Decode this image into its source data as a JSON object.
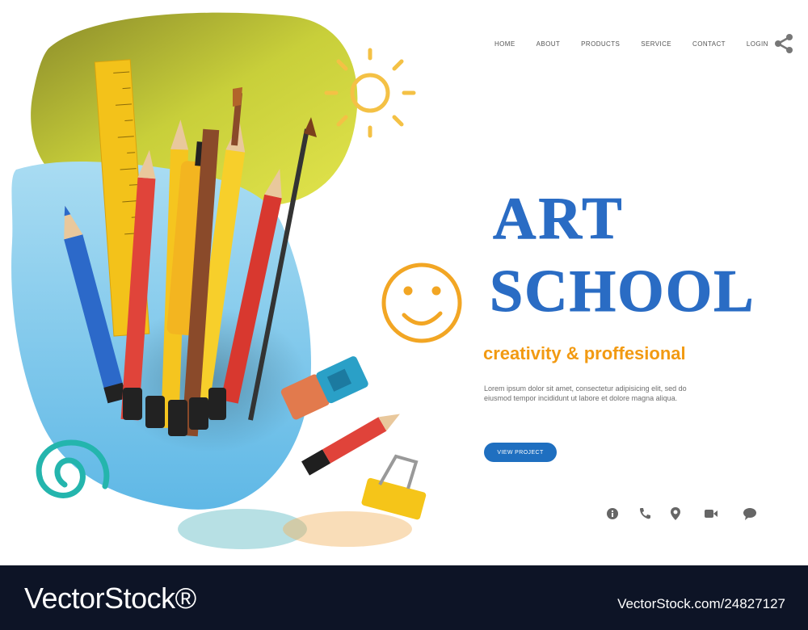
{
  "nav": {
    "items": [
      {
        "label": "HOME"
      },
      {
        "label": "ABOUT"
      },
      {
        "label": "PRODUCTS"
      },
      {
        "label": "SERVICE"
      },
      {
        "label": "CONTACT"
      },
      {
        "label": "LOGIN"
      }
    ],
    "share_icon": "share-icon"
  },
  "hero": {
    "title_line1": "ART",
    "title_line2": "SCHOOL",
    "tagline": "creativity & proffesional",
    "body": "Lorem ipsum dolor sit amet, consectetur adipisicing elit, sed do eiusmod tempor incididunt ut labore et dolore magna aliqua.",
    "cta_label": "VIEW PROJECT"
  },
  "contact_icons": [
    "info-icon",
    "phone-icon",
    "location-icon",
    "video-icon",
    "chat-icon"
  ],
  "watermark": {
    "logo": "VectorStock®",
    "url": "VectorStock.com/24827127"
  },
  "colors": {
    "accent_blue": "#1f6fc0",
    "title_blue": "#2a6cc4",
    "tagline_orange": "#f29a12",
    "banner": "#0d1426"
  }
}
